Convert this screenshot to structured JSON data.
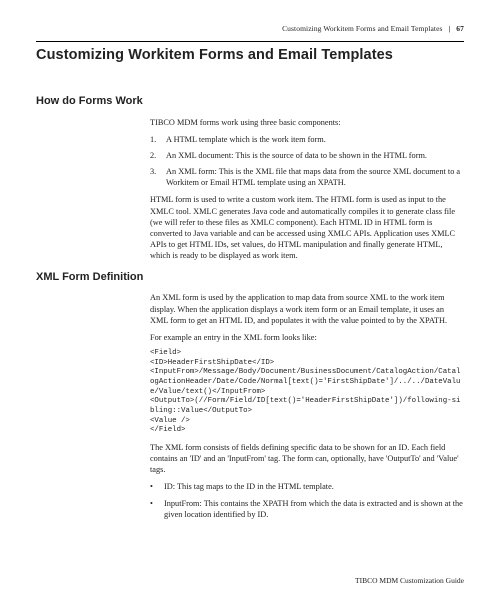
{
  "header": {
    "running_title": "Customizing Workitem Forms and Email Templates",
    "page_number": "67"
  },
  "chapter_title": "Customizing Workitem Forms and Email Templates",
  "section1": {
    "title": "How do Forms Work",
    "intro": "TIBCO MDM forms work using three basic components:",
    "items": [
      {
        "num": "1.",
        "text": "A HTML template which is the work item form."
      },
      {
        "num": "2.",
        "text": "An XML document: This is the source of data to be shown in the HTML form."
      },
      {
        "num": "3.",
        "text": "An XML form: This is the XML file that maps data from the source XML document to a Workitem or Email HTML template using an XPATH."
      }
    ],
    "para2": "HTML form is used to write a custom work item. The HTML form is used as input to the XMLC tool. XMLC generates Java code and automatically compiles it to generate class file (we will refer to these files as XMLC component). Each HTML ID in HTML form is converted to Java variable and can be accessed using XMLC APIs. Application uses XMLC APIs to get HTML IDs, set values, do HTML manipulation and finally generate HTML, which is ready to be displayed as work item."
  },
  "section2": {
    "title": "XML Form Definition",
    "para1": "An XML form is used by the application to map data from source XML to the work item display. When the application displays a work item form or an Email template, it uses an XML form to get an HTML ID, and populates it with the value pointed to by the XPATH.",
    "para2": "For example an entry in the XML form looks like:",
    "code": "<Field>\n<ID>HeaderFirstShipDate</ID>\n<InputFrom>/Message/Body/Document/BusinessDocument/CatalogAction/CatalogActionHeader/Date/Code/Normal[text()='FirstShipDate']/../../DateValue/Value/text()</InputFrom>\n<OutputTo>(//Form/Field/ID[text()='HeaderFirstShipDate'])/following-sibling::Value</OutputTo>\n<Value />\n</Field>",
    "para3": "The XML form consists of fields defining specific data to be shown for an ID. Each field contains an 'ID' and an 'InputFrom' tag. The form can, optionally, have 'OutputTo' and 'Value' tags.",
    "bullets": [
      "ID: This tag maps to the ID in the HTML template.",
      "InputFrom: This contains the XPATH from which the data is extracted and is shown at the given location identified by ID."
    ]
  },
  "footer": "TIBCO MDM Customization Guide"
}
